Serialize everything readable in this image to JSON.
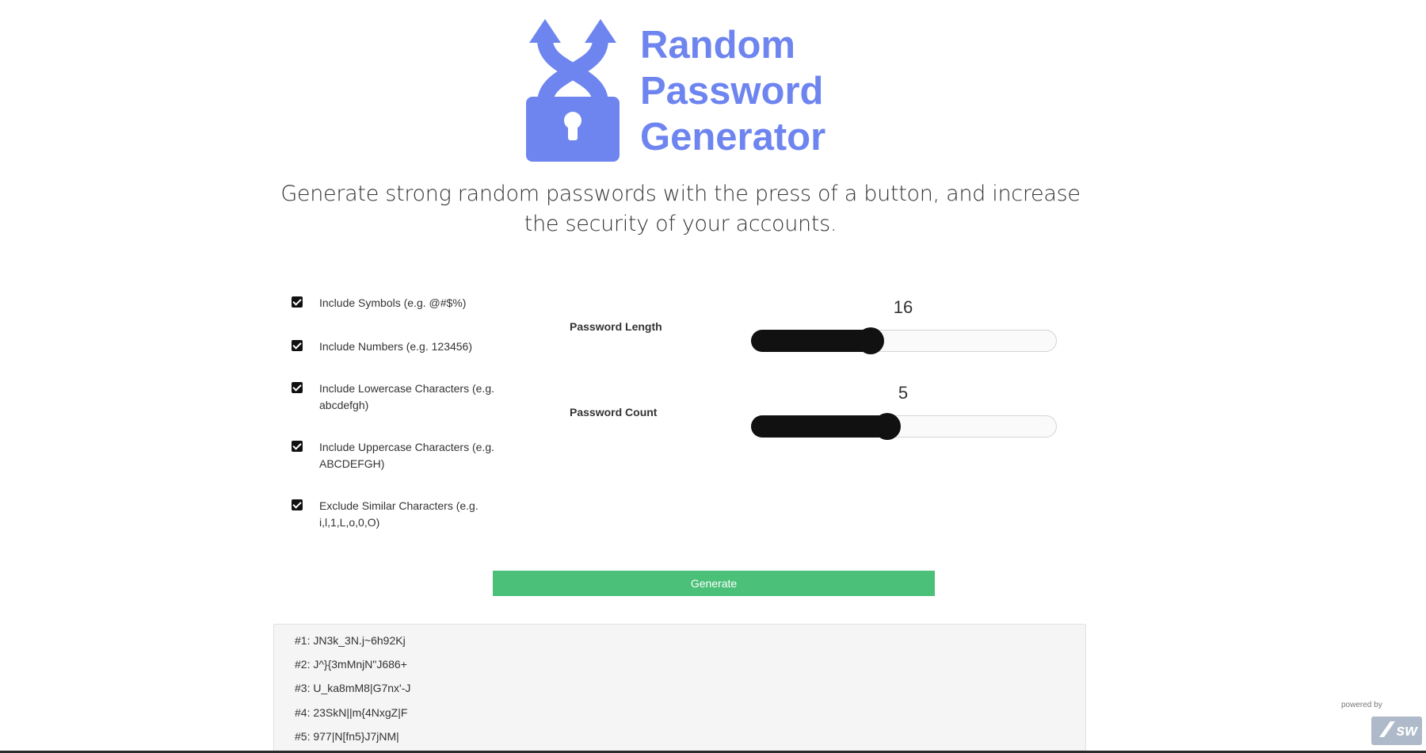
{
  "logo": {
    "icon": "shuffle-padlock-icon",
    "line1": "Random",
    "line2": "Password",
    "line3": "Generator",
    "color": "#6e85f0"
  },
  "tagline": "Generate strong random passwords with the press of a button, and increase the security of your accounts.",
  "options": [
    {
      "label": "Include Symbols (e.g. @#$%)",
      "checked": true
    },
    {
      "label": "Include Numbers (e.g. 123456)",
      "checked": true
    },
    {
      "label": "Include Lowercase Characters (e.g. abcdefgh)",
      "checked": true
    },
    {
      "label": "Include Uppercase Characters (e.g. ABCDEFGH)",
      "checked": true
    },
    {
      "label": "Exclude Similar Characters (e.g. i,l,1,L,o,0,O)",
      "checked": true
    }
  ],
  "sliders": {
    "length": {
      "label": "Password Length",
      "value": "16",
      "fraction": 0.39
    },
    "count": {
      "label": "Password Count",
      "value": "5",
      "fraction": 0.445
    }
  },
  "generate_label": "Generate",
  "generate_color": "#4bc079",
  "results": [
    "#1: JN3k_3N.j~6h92Kj",
    "#2: J^}{3mMnjN\"J686+",
    "#3: U_ka8mM8|G7nx'-J",
    "#4: 23SkN||m{4NxgZ|F",
    "#5: 977|N[fn5}J7jNM|"
  ],
  "powered_by": "powered by",
  "badge": "sw"
}
